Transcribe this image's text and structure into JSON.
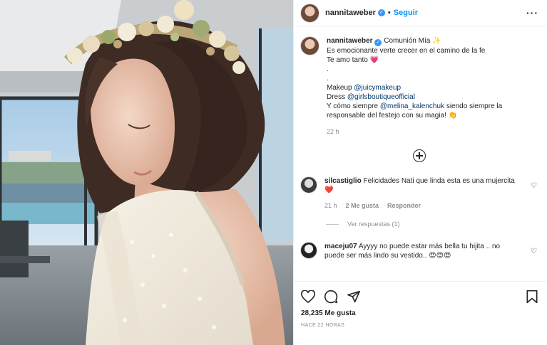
{
  "post": {
    "username": "nannitaweber",
    "follow_label": "Seguir",
    "separator": "•",
    "more_label": "···",
    "caption": {
      "first_line_text": "Comunión Mía ✨",
      "lines": [
        "Es emocionante verte crecer en el camino de la fe",
        "Te amo tanto 💗",
        ".",
        "."
      ],
      "makeup_prefix": "Makeup ",
      "makeup_mention": "@juicymakeup",
      "dress_prefix": "Dress ",
      "dress_mention": "@girlsboutiqueofficial",
      "closing_prefix": "Y cómo siempre ",
      "closing_mention": "@melina_kalenchuk",
      "closing_suffix": " siendo siempre la responsable del festejo con su magia! 👏"
    },
    "caption_time": "22 h",
    "comments": [
      {
        "username": "silcastiglio",
        "text": "Felicidades Nati que linda esta es una mujercita ❤️",
        "time": "21 h",
        "likes": "2 Me gusta",
        "reply_label": "Responder",
        "view_replies": "Ver respuestas (1)"
      },
      {
        "username": "maceju07",
        "text": "Ayyyy no puede estar más bella tu hijita .. no puede ser más lindo su vestido.. 😍😍😍"
      }
    ],
    "likes_count": "28,235 Me gusta",
    "posted_ago": "HACE 22 HORAS"
  },
  "icons": {
    "verified": "verified-badge-icon",
    "like": "heart-icon",
    "comment": "comment-icon",
    "share": "share-icon",
    "save": "bookmark-icon",
    "add": "plus-circle-icon"
  },
  "colors": {
    "link": "#0095f6",
    "mention": "#00376b",
    "muted": "#8e8e8e",
    "verified": "#3897f0",
    "border": "#efefef"
  }
}
